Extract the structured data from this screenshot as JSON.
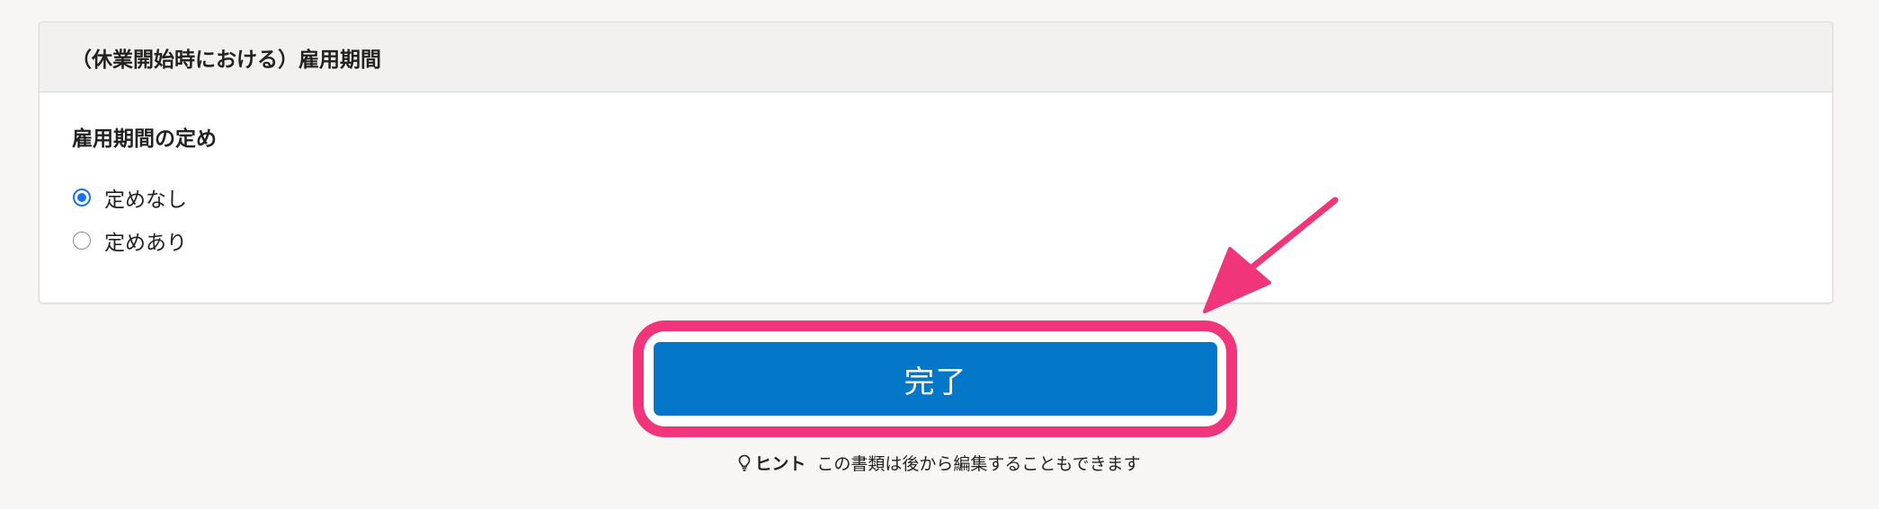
{
  "section": {
    "title": "（休業開始時における）雇用期間"
  },
  "field": {
    "label": "雇用期間の定め",
    "options": [
      {
        "label": "定めなし",
        "selected": true
      },
      {
        "label": "定めあり",
        "selected": false
      }
    ]
  },
  "actions": {
    "done_label": "完了"
  },
  "hint": {
    "icon": "lightbulb-icon",
    "title": "ヒント",
    "text": "この書類は後から編集することもできます"
  },
  "colors": {
    "primary_button": "#0577c8",
    "highlight": "#f0357a",
    "radio_selected": "#1a73e8",
    "background": "#f7f6f5"
  }
}
